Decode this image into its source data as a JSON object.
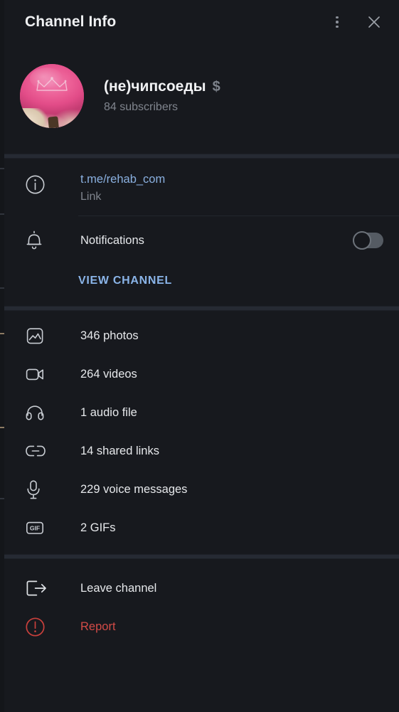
{
  "header": {
    "title": "Channel Info",
    "menu_icon": "kebab-menu-icon",
    "close_icon": "close-icon"
  },
  "profile": {
    "avatar_icon": "channel-avatar",
    "name": "(не)чипсоеды",
    "badge": "$",
    "subscribers": "84 subscribers"
  },
  "info_section": {
    "link": {
      "icon": "info-circle-icon",
      "value": "t.me/rehab_com",
      "caption": "Link"
    },
    "notifications": {
      "icon": "bell-icon",
      "label": "Notifications",
      "toggle_state": "off"
    },
    "view_channel": "VIEW CHANNEL"
  },
  "media_section": {
    "items": [
      {
        "icon": "photo-icon",
        "label": "346 photos"
      },
      {
        "icon": "video-camera-icon",
        "label": "264 videos"
      },
      {
        "icon": "headphones-icon",
        "label": "1 audio file"
      },
      {
        "icon": "link-chain-icon",
        "label": "14 shared links"
      },
      {
        "icon": "microphone-icon",
        "label": "229 voice messages"
      },
      {
        "icon": "gif-icon",
        "label": "2 GIFs"
      }
    ]
  },
  "footer_section": {
    "items": [
      {
        "icon": "exit-arrow-icon",
        "label": "Leave channel",
        "danger": false
      },
      {
        "icon": "alert-circle-icon",
        "label": "Report",
        "danger": true
      }
    ]
  },
  "colors": {
    "background": "#17191e",
    "band": "#262a33",
    "accent_link": "#8ab4e8",
    "link_text": "#8ab0e0",
    "danger": "#d34b47",
    "primary_text": "#e6e8eb",
    "secondary_text": "#7f848d"
  }
}
